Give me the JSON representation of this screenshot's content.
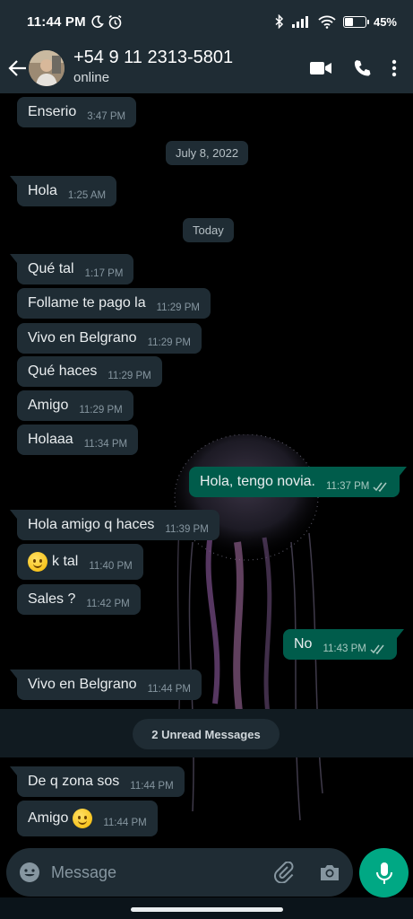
{
  "status_bar": {
    "time": "11:44 PM",
    "battery": "45%",
    "battery_level": 0.45
  },
  "header": {
    "contact_name": "+54 9 11 2313-5801",
    "status": "online"
  },
  "messages": [
    {
      "dir": "in",
      "text": "Enserio",
      "time": "3:47 PM"
    },
    {
      "dir": "in",
      "text": "Hola",
      "time": "1:25 AM"
    },
    {
      "dir": "in",
      "text": "Qué tal",
      "time": "1:17 PM"
    },
    {
      "dir": "in",
      "text": "Follame te pago la",
      "time": "11:29 PM"
    },
    {
      "dir": "in",
      "text": "Vivo en Belgrano",
      "time": "11:29 PM"
    },
    {
      "dir": "in",
      "text": "Qué haces",
      "time": "11:29 PM"
    },
    {
      "dir": "in",
      "text": "Amigo",
      "time": "11:29 PM"
    },
    {
      "dir": "in",
      "text": "Holaaa",
      "time": "11:34 PM"
    },
    {
      "dir": "out",
      "text": "Hola, tengo novia.",
      "time": "11:37 PM"
    },
    {
      "dir": "in",
      "text": "Hola amigo q haces",
      "time": "11:39 PM"
    },
    {
      "dir": "in",
      "text": "k tal",
      "time": "11:40 PM",
      "emoji": "slightly-smiling-face"
    },
    {
      "dir": "in",
      "text": "Sales ?",
      "time": "11:42 PM"
    },
    {
      "dir": "out",
      "text": "No",
      "time": "11:43 PM"
    },
    {
      "dir": "in",
      "text": "Vivo en Belgrano",
      "time": "11:44 PM"
    },
    {
      "dir": "in",
      "text": "De q zona sos",
      "time": "11:44 PM"
    },
    {
      "dir": "in",
      "text": "Amigo",
      "time": "11:44 PM",
      "emoji": "smiling-face"
    }
  ],
  "date_chips": [
    "July 8, 2022",
    "Today"
  ],
  "unread_label": "2 Unread Messages",
  "composer": {
    "placeholder": "Message"
  },
  "colors": {
    "header": "#1f2c34",
    "incoming": "#1f2c34",
    "outgoing": "#005c4b",
    "accent": "#00a884"
  }
}
